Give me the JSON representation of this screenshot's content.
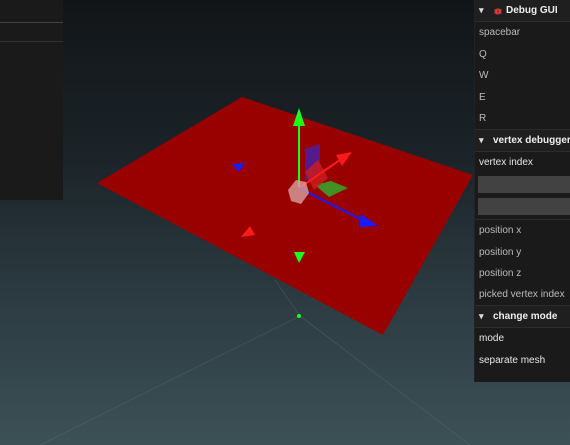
{
  "gui": {
    "title": "Debug GUI",
    "items": [
      "spacebar",
      "Q",
      "W",
      "E",
      "R"
    ],
    "vertex_debugger": {
      "title": "vertex debugger",
      "vertex_index_label": "vertex index",
      "fields": [
        "",
        ""
      ],
      "props": [
        "position x",
        "position y",
        "position z",
        "picked vertex index"
      ]
    },
    "change_mode": {
      "title": "change mode",
      "items": [
        "mode",
        "separate mesh"
      ]
    }
  },
  "colors": {
    "plane": "#990000",
    "gizmo_x": "#ff1a1a",
    "gizmo_y": "#1aff1a",
    "gizmo_z": "#1a1aff",
    "panel": "#1a1a1a",
    "field": "#424242"
  },
  "icons": [
    "chevron-down-icon",
    "bug-icon"
  ]
}
